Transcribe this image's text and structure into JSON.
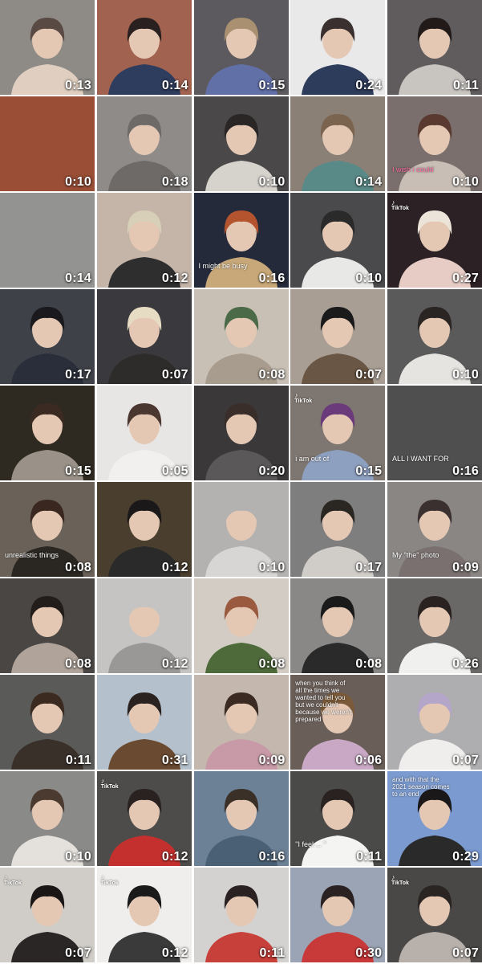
{
  "tiles": [
    {
      "duration": "0:13",
      "bg": "#8e8a86",
      "fig": "#e0cfc0",
      "hair": "#5a4a44"
    },
    {
      "duration": "0:14",
      "bg": "#a26250",
      "fig": "#2e3d5e",
      "hair": "#2a2020"
    },
    {
      "duration": "0:15",
      "bg": "#5c5a5e",
      "fig": "#6270a8",
      "hair": "#a89070"
    },
    {
      "duration": "0:24",
      "bg": "#e9e9e9",
      "fig": "#2e3c5c",
      "hair": "#3a3030"
    },
    {
      "duration": "0:11",
      "bg": "#605c5e",
      "fig": "#c8c4c0",
      "hair": "#221a18"
    },
    {
      "duration": "0:10",
      "bg": "#b0593e",
      "fig": "#b0593e",
      "hair": "#b0593e"
    },
    {
      "duration": "0:18",
      "bg": "#8e8b88",
      "fig": "#6e6a68",
      "hair": "#6e6a68"
    },
    {
      "duration": "0:10",
      "bg": "#4a4848",
      "fig": "#d6d2cc",
      "hair": "#2a2626"
    },
    {
      "duration": "0:14",
      "bg": "#8a8076",
      "fig": "#5a8a88",
      "hair": "#7a6450"
    },
    {
      "duration": "0:10",
      "bg": "#7a6f6c",
      "fig": "#c8beb6",
      "hair": "#5a3a30",
      "caption": "I wish i could",
      "pink": true
    },
    {
      "duration": "0:14",
      "bg": "#a8a8a6",
      "fig": "#a8a8a6",
      "hair": "#a8a8a6"
    },
    {
      "duration": "0:12",
      "bg": "#c4b5a8",
      "fig": "#2e2e2e",
      "hair": "#d8cfb8"
    },
    {
      "duration": "0:16",
      "bg": "#252a3a",
      "fig": "#c8a878",
      "hair": "#b4542e",
      "caption": "I might be busy"
    },
    {
      "duration": "0:10",
      "bg": "#4a4a4c",
      "fig": "#e8e8e6",
      "hair": "#2a2a2a"
    },
    {
      "duration": "0:27",
      "bg": "#2c2226",
      "fig": "#e6ccc4",
      "hair": "#ece4d8",
      "badge": "TikTok"
    },
    {
      "duration": "0:17",
      "bg": "#3e4248",
      "fig": "#2a2e3a",
      "hair": "#1a1a1e"
    },
    {
      "duration": "0:07",
      "bg": "#3a3a3e",
      "fig": "#2e2c2a",
      "hair": "#e6dcc4"
    },
    {
      "duration": "0:08",
      "bg": "#c8c0b4",
      "fig": "#a89c8e",
      "hair": "#4a6a48"
    },
    {
      "duration": "0:07",
      "bg": "#a89e94",
      "fig": "#6a5644",
      "hair": "#1a1a1a"
    },
    {
      "duration": "0:10",
      "bg": "#5a5a5a",
      "fig": "#e6e4e0",
      "hair": "#2a2422"
    },
    {
      "duration": "0:15",
      "bg": "#2e2a22",
      "fig": "#9a9288",
      "hair": "#3a2a22"
    },
    {
      "duration": "0:05",
      "bg": "#e8e6e4",
      "fig": "#f2f0ee",
      "hair": "#4a3830"
    },
    {
      "duration": "0:20",
      "bg": "#3a3838",
      "fig": "#5a5858",
      "hair": "#3a2e2a"
    },
    {
      "duration": "0:15",
      "bg": "#7e7670",
      "fig": "#8ea0c0",
      "hair": "#6a3a7a",
      "caption": "i am out of",
      "badge": "TikTok"
    },
    {
      "duration": "0:16",
      "bg": "#5a5a5a",
      "fig": "#5a5a5a",
      "hair": "#5a5a5a",
      "caption": "ALL I WANT FOR"
    },
    {
      "duration": "0:08",
      "bg": "#6a6258",
      "fig": "#2a2622",
      "hair": "#3a2820",
      "caption": "unrealistic things"
    },
    {
      "duration": "0:12",
      "bg": "#4a3e2e",
      "fig": "#2a2a2a",
      "hair": "#1a1818"
    },
    {
      "duration": "0:10",
      "bg": "#b4b2b0",
      "fig": "#d8d6d4",
      "hair": "#b4b2b0"
    },
    {
      "duration": "0:17",
      "bg": "#7e7e7e",
      "fig": "#d0ccc8",
      "hair": "#2a2622"
    },
    {
      "duration": "0:09",
      "bg": "#8a8684",
      "fig": "#7a7070",
      "hair": "#3a3030",
      "caption": "My \"the\" photo"
    },
    {
      "duration": "0:08",
      "bg": "#4a4644",
      "fig": "#b0a49a",
      "hair": "#221c1a"
    },
    {
      "duration": "0:12",
      "bg": "#c6c4c2",
      "fig": "#9a9896",
      "hair": "#c6c4c2"
    },
    {
      "duration": "0:08",
      "bg": "#d2ccc4",
      "fig": "#4e6a3a",
      "hair": "#9a5a40"
    },
    {
      "duration": "0:08",
      "bg": "#8a8886",
      "fig": "#2a2a2a",
      "hair": "#1a1a1a"
    },
    {
      "duration": "0:26",
      "bg": "#6a6866",
      "fig": "#f0f0ee",
      "hair": "#2a2220"
    },
    {
      "duration": "0:11",
      "bg": "#5a5a58",
      "fig": "#3a302a",
      "hair": "#3a2a20"
    },
    {
      "duration": "0:31",
      "bg": "#b4c0cc",
      "fig": "#6a4a30",
      "hair": "#2a2220"
    },
    {
      "duration": "0:09",
      "bg": "#c4b8ae",
      "fig": "#c89aa8",
      "hair": "#3a2a22"
    },
    {
      "duration": "0:06",
      "bg": "#6a5e58",
      "fig": "#c8a8c4",
      "hair": "#7a5a38",
      "caption": "when you think of all the times we wanted to tell you but we couldn't because we weren't prepared"
    },
    {
      "duration": "0:07",
      "bg": "#aeaeb0",
      "fig": "#f0eeec",
      "hair": "#b4a6c8"
    },
    {
      "duration": "0:10",
      "bg": "#8a8a88",
      "fig": "#e4e0dc",
      "hair": "#4a3a30"
    },
    {
      "duration": "0:12",
      "bg": "#4e4c4a",
      "fig": "#c4302e",
      "hair": "#2a2220",
      "badge": "TikTok"
    },
    {
      "duration": "0:16",
      "bg": "#6c8096",
      "fig": "#4a6074",
      "hair": "#3a3028"
    },
    {
      "duration": "0:11",
      "bg": "#4a4a48",
      "fig": "#f4f4f2",
      "hair": "#2a2220",
      "caption": "\"I feel ... \""
    },
    {
      "duration": "0:29",
      "bg": "#7a9ad0",
      "fig": "#2a2a2a",
      "hair": "#1a1818",
      "caption": "and with that the 2021 season comes to an end"
    },
    {
      "duration": "0:07",
      "bg": "#d0ccc8",
      "fig": "#2a2626",
      "hair": "#1a1616",
      "badge": "TikTok"
    },
    {
      "duration": "0:12",
      "bg": "#f0eeec",
      "fig": "#3a3a3a",
      "hair": "#1a1a1a",
      "badge": "TikTok"
    },
    {
      "duration": "0:11",
      "bg": "#d4d2d0",
      "fig": "#c8403a",
      "hair": "#2a2222"
    },
    {
      "duration": "0:30",
      "bg": "#9aa4b4",
      "fig": "#c83a3a",
      "hair": "#2a2222"
    },
    {
      "duration": "0:07",
      "bg": "#4a4846",
      "fig": "#b8b0aa",
      "hair": "#2a2422",
      "badge": "TikTok"
    }
  ]
}
